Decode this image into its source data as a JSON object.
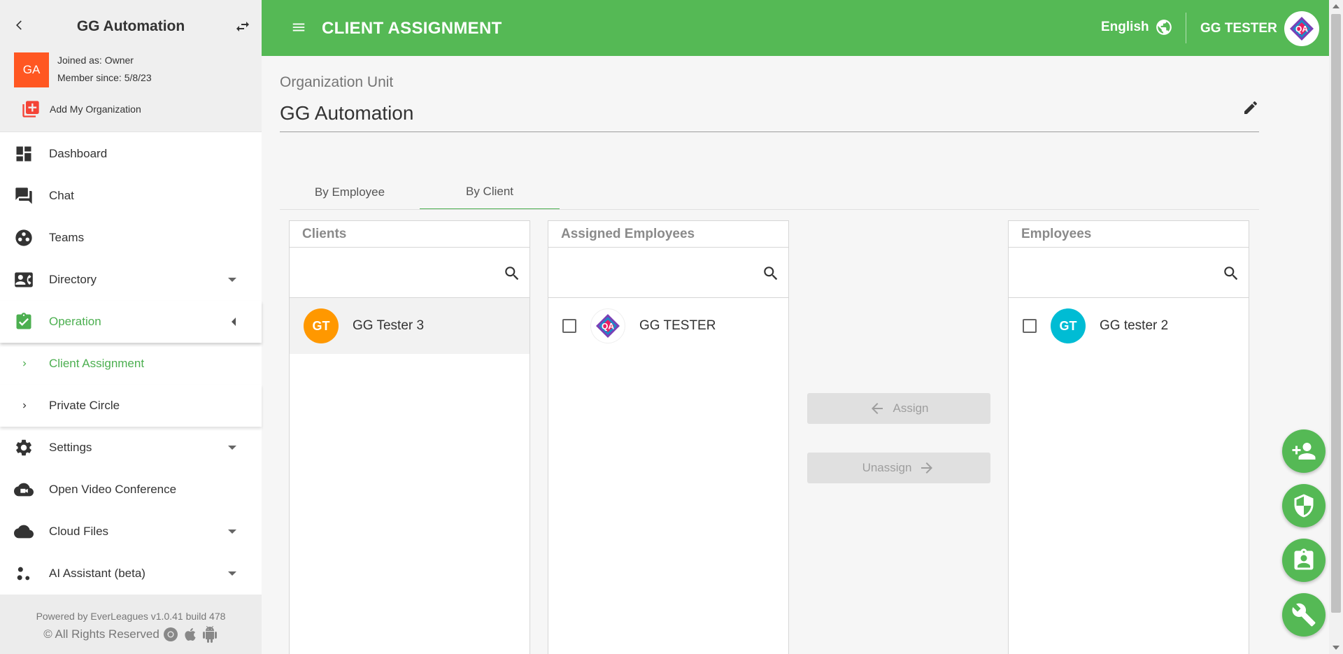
{
  "sidebar": {
    "org_name": "GG Automation",
    "org_initials": "GA",
    "joined_as": "Joined as: Owner",
    "member_since": "Member since: 5/8/23",
    "add_org": "Add My Organization",
    "items": [
      {
        "label": "Dashboard"
      },
      {
        "label": "Chat"
      },
      {
        "label": "Teams"
      },
      {
        "label": "Directory"
      },
      {
        "label": "Operation"
      },
      {
        "label": "Settings"
      },
      {
        "label": "Open Video Conference"
      },
      {
        "label": "Cloud Files"
      },
      {
        "label": "AI Assistant (beta)"
      }
    ],
    "sub_items": [
      {
        "label": "Client Assignment"
      },
      {
        "label": "Private Circle"
      }
    ],
    "footer_powered": "Powered by EverLeagues v1.0.41 build 478",
    "footer_rights": "© All Rights Reserved"
  },
  "header": {
    "title": "CLIENT ASSIGNMENT",
    "language": "English",
    "user_name": "GG TESTER"
  },
  "main": {
    "org_unit_label": "Organization Unit",
    "org_unit_value": "GG Automation",
    "tabs": [
      {
        "label": "By Employee"
      },
      {
        "label": "By Client"
      }
    ],
    "clients": {
      "title": "Clients",
      "search_placeholder": "",
      "rows": [
        {
          "initials": "GT",
          "name": "GG Tester 3",
          "color": "#ff9800"
        }
      ]
    },
    "assigned": {
      "title": "Assigned Employees",
      "search_placeholder": "",
      "rows": [
        {
          "name": "GG TESTER"
        }
      ]
    },
    "employees": {
      "title": "Employees",
      "search_placeholder": "",
      "rows": [
        {
          "initials": "GT",
          "name": "GG tester 2",
          "color": "#00bcd4"
        }
      ]
    },
    "assign_label": "Assign",
    "unassign_label": "Unassign"
  },
  "colors": {
    "brand_green": "#55b955",
    "active_green": "#4caf50",
    "org_avatar": "#ff5722"
  }
}
